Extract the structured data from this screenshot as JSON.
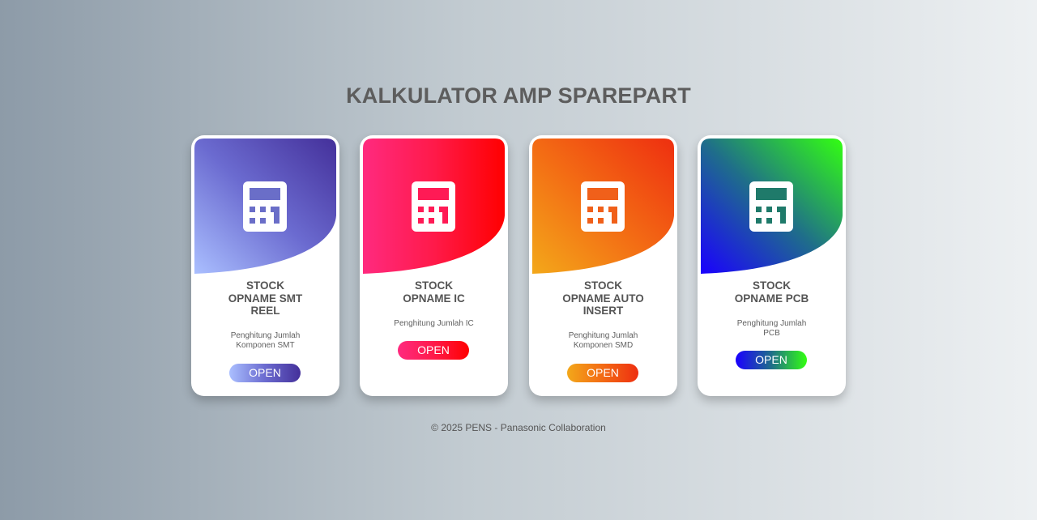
{
  "page": {
    "title": "KALKULATOR AMP SPAREPART",
    "footer": "© 2025 PENS - Panasonic Collaboration"
  },
  "cards": [
    {
      "title": "STOCK\nOPNAME SMT\nREEL",
      "description": "Penghitung Jumlah\nKomponen SMT",
      "button_label": "OPEN",
      "icon": "calculator-icon",
      "gradient": [
        "#aabfff",
        "#6b6bd0",
        "#44309a"
      ],
      "icon_detail_color": "#6a6ec8"
    },
    {
      "title": "STOCK\nOPNAME IC",
      "description": "Penghitung Jumlah IC",
      "button_label": "OPEN",
      "icon": "calculator-icon",
      "gradient": [
        "#ff2a7f",
        "#ff1a4a",
        "#ff0000"
      ],
      "icon_detail_color": "#ff1a55"
    },
    {
      "title": "STOCK\nOPNAME AUTO\nINSERT",
      "description": "Penghitung Jumlah\nKomponen SMD",
      "button_label": "OPEN",
      "icon": "calculator-icon",
      "gradient": [
        "#f3a81a",
        "#f36a14",
        "#ee2f10"
      ],
      "icon_detail_color": "#f0601a"
    },
    {
      "title": "STOCK\nOPNAME PCB",
      "description": "Penghitung Jumlah\nPCB",
      "button_label": "OPEN",
      "icon": "calculator-icon",
      "gradient": [
        "#1a00ff",
        "#1f6e8a",
        "#33ff11"
      ],
      "icon_detail_color": "#1f7a6a"
    }
  ]
}
